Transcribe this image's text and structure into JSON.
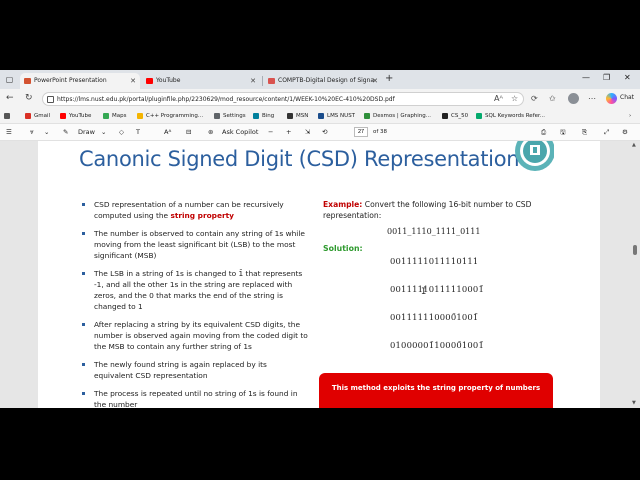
{
  "tabs": [
    {
      "label": "PowerPoint Presentation",
      "active": true,
      "icon_color": "#d35230"
    },
    {
      "label": "YouTube",
      "active": false,
      "icon_color": "#ff0000"
    },
    {
      "label": "COMPTB-Digital Design of Signa",
      "active": false,
      "icon_color": "#d9534f"
    }
  ],
  "address": {
    "url": "https://lms.nust.edu.pk/portal/pluginfile.php/2230629/mod_resource/content/1/WEEK-10%20EC-410%20DSD.pdf",
    "chat_label": "Chat"
  },
  "bookmarks": [
    {
      "label": "Gmail",
      "icon_color": "#d93025"
    },
    {
      "label": "YouTube",
      "icon_color": "#ff0000"
    },
    {
      "label": "Maps",
      "icon_color": "#34a853"
    },
    {
      "label": "C++ Programming...",
      "icon_color": "#f4b400"
    },
    {
      "label": "Settings",
      "icon_color": "#5f6368"
    },
    {
      "label": "Bing",
      "icon_color": "#00809d"
    },
    {
      "label": "MSN",
      "icon_color": "#333333"
    },
    {
      "label": "LMS NUST",
      "icon_color": "#1a4c8b"
    },
    {
      "label": "Desmos | Graphing...",
      "icon_color": "#2f8f3a"
    },
    {
      "label": "CS_50",
      "icon_color": "#222222"
    },
    {
      "label": "SQL Keywords Refer...",
      "icon_color": "#04aa6d"
    }
  ],
  "pdf_toolbar": {
    "draw_label": "Draw",
    "copilot_label": "Ask Copilot",
    "page_current": "27",
    "page_total": "of 38"
  },
  "slide": {
    "title": "Canonic Signed Digit (CSD) Representation",
    "bullets": [
      {
        "pre": "CSD representation of a number can be recursively computed using the ",
        "em": "string property",
        "post": ""
      },
      {
        "pre": "The number is observed to contain any string of 1s while moving from the least significant bit (LSB) to the most significant (MSB)",
        "em": "",
        "post": ""
      },
      {
        "pre": "The LSB in a string of 1s is changed to 1̄ that represents -1, and all the other 1s in the string are replaced with zeros, and the 0 that marks the end of the string is changed to 1",
        "em": "",
        "post": ""
      },
      {
        "pre": "After replacing a string by its equivalent CSD digits, the number is observed again moving from the coded digit to the MSB to contain any further string of 1s",
        "em": "",
        "post": ""
      },
      {
        "pre": "The newly found string is again replaced by its equivalent CSD representation",
        "em": "",
        "post": ""
      },
      {
        "pre": "The process is repeated until no string of 1s is found in the number",
        "em": "",
        "post": ""
      }
    ],
    "example_label": "Example:",
    "example_text": " Convert the following 16-bit number to CSD representation:",
    "binary": "0011_1110_1111_0111",
    "solution_label": "Solution:",
    "steps": [
      "0011111011110111",
      "00111110111110001̄",
      "001111110000̄1001̄",
      "01000001̄10000̄1001̄"
    ],
    "banner": "This method exploits the string property of numbers"
  },
  "colors": {
    "title_blue": "#2c5f9e",
    "accent_red": "#c00000",
    "solution_green": "#2e9a2e",
    "banner_red": "#e00000"
  }
}
